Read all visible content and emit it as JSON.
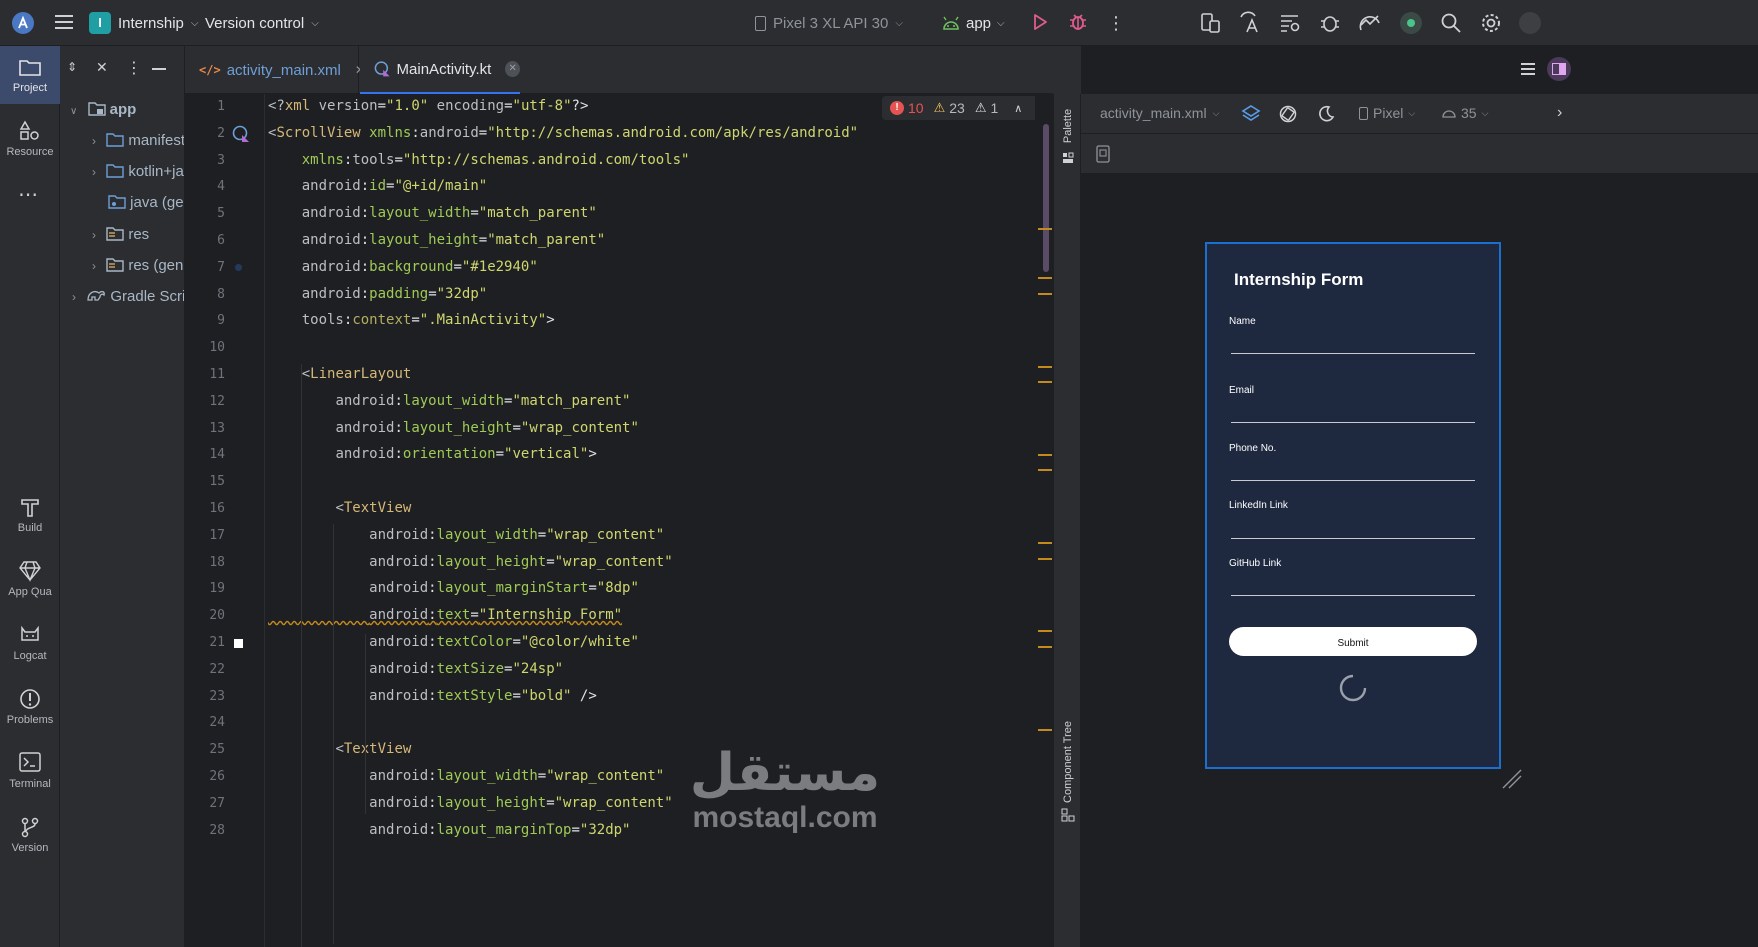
{
  "topbar": {
    "project_badge": "I",
    "project_name": "Internship",
    "vcs_label": "Version control",
    "device": "Pixel 3 XL API 30",
    "run_config": "app"
  },
  "leftstrip": {
    "items": [
      {
        "label": "Project"
      },
      {
        "label": "Resource"
      },
      {
        "label": "Build"
      },
      {
        "label": "App Qua"
      },
      {
        "label": "Logcat"
      },
      {
        "label": "Problems"
      },
      {
        "label": "Terminal"
      },
      {
        "label": "Version"
      }
    ]
  },
  "project_tree": {
    "items": [
      {
        "label": "app"
      },
      {
        "label": "manifests"
      },
      {
        "label": "kotlin+java"
      },
      {
        "label": "java (generated)"
      },
      {
        "label": "res"
      },
      {
        "label": "res (generated)"
      },
      {
        "label": "Gradle Scripts"
      }
    ]
  },
  "tabs": [
    {
      "label": "activity_main.xml"
    },
    {
      "label": "MainActivity.kt"
    }
  ],
  "inspection": {
    "errors": "10",
    "warnings": "23",
    "weak": "1"
  },
  "code_lines": [
    "<?xml version=\"1.0\" encoding=\"utf-8\"?>",
    "<ScrollView xmlns:android=\"http://schemas.android.com/apk/res/android\"",
    "    xmlns:tools=\"http://schemas.android.com/tools\"",
    "    android:id=\"@+id/main\"",
    "    android:layout_width=\"match_parent\"",
    "    android:layout_height=\"match_parent\"",
    "    android:background=\"#1e2940\"",
    "    android:padding=\"32dp\"",
    "    tools:context=\".MainActivity\">",
    "",
    "    <LinearLayout",
    "        android:layout_width=\"match_parent\"",
    "        android:layout_height=\"wrap_content\"",
    "        android:orientation=\"vertical\">",
    "",
    "        <TextView",
    "            android:layout_width=\"wrap_content\"",
    "            android:layout_height=\"wrap_content\"",
    "            android:layout_marginStart=\"8dp\"",
    "            android:text=\"Internship Form\"",
    "            android:textColor=\"@color/white\"",
    "            android:textSize=\"24sp\"",
    "            android:textStyle=\"bold\" />",
    "",
    "        <TextView",
    "            android:layout_width=\"wrap_content\"",
    "            android:layout_height=\"wrap_content\"",
    "            android:layout_marginTop=\"32dp\""
  ],
  "design_toolbar": {
    "file": "activity_main.xml",
    "device": "Pixel",
    "api": "35"
  },
  "side_labels": {
    "palette": "Palette",
    "component_tree": "Component Tree"
  },
  "preview": {
    "title": "Internship Form",
    "fields": [
      "Name",
      "Email",
      "Phone No.",
      "LinkedIn Link",
      "GitHub Link"
    ],
    "submit": "Submit"
  },
  "watermark": {
    "arabic": "مستقل",
    "latin": "mostaql.com"
  },
  "colors": {
    "accent": "#1b6fd1",
    "form_bg": "#1e2940",
    "error": "#e55353",
    "warning": "#f2c55c"
  }
}
